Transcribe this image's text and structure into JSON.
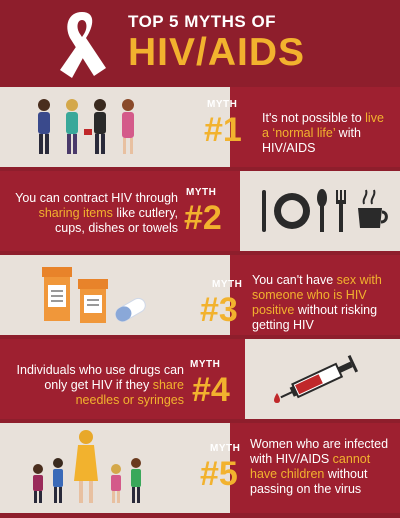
{
  "header": {
    "title_top": "TOP 5 MYTHS OF",
    "title_main": "HIV/AIDS",
    "ribbon_icon": "awareness-ribbon-icon"
  },
  "colors": {
    "background": "#8e1e2c",
    "panel_dark": "#9e2030",
    "panel_light": "#e8e1da",
    "accent": "#f2b22e",
    "text": "#ffffff"
  },
  "myths": [
    {
      "word": "MYTH",
      "number": "#1",
      "text_parts": [
        "It's not possible to ",
        "live a ‘normal life’",
        " with HIV/AIDS"
      ],
      "icon": "people-group-icon"
    },
    {
      "word": "MYTH",
      "number": "#2",
      "text_parts": [
        "You can contract HIV through ",
        "sharing items",
        " like cutlery, cups, dishes or towels"
      ],
      "icon": "tableware-icon"
    },
    {
      "word": "MYTH",
      "number": "#3",
      "text_parts": [
        "You can't have ",
        "sex with someone who is HIV positive",
        " without risking getting HIV"
      ],
      "icon": "medicine-bottles-icon"
    },
    {
      "word": "MYTH",
      "number": "#4",
      "text_parts": [
        "Individuals who use drugs can only get HIV if they ",
        "share needles or syringes",
        ""
      ],
      "icon": "syringe-icon"
    },
    {
      "word": "MYTH",
      "number": "#5",
      "text_parts": [
        "Women who are infected with HIV/AIDS ",
        "cannot have children",
        " without passing on the virus"
      ],
      "icon": "family-icon"
    }
  ]
}
